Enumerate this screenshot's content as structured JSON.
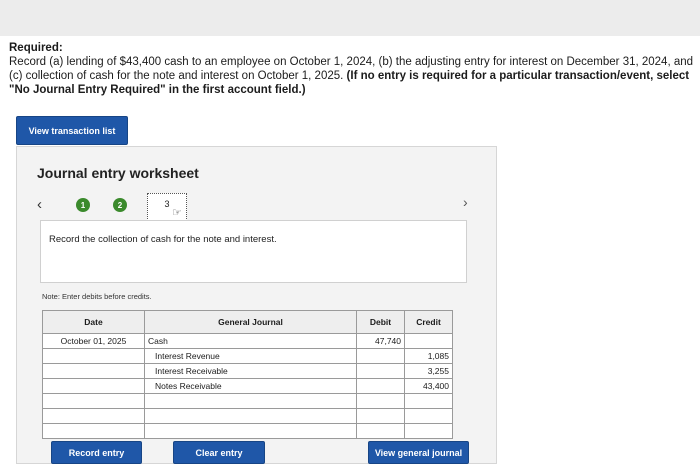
{
  "required": {
    "title": "Required:",
    "body": "Record (a) lending of $43,400 cash to an employee on October 1, 2024, (b) the adjusting entry for interest on December 31, 2024, and (c) collection of cash for the note and interest on October 1, 2025.",
    "bold_note": "(If no entry is required for a particular transaction/event, select \"No Journal Entry Required\" in the first account field.)"
  },
  "buttons": {
    "view_transaction_list": "View transaction list",
    "record_entry": "Record entry",
    "clear_entry": "Clear entry",
    "view_general_journal": "View general journal"
  },
  "worksheet": {
    "title": "Journal entry worksheet",
    "steps": [
      "1",
      "2",
      "3"
    ],
    "current_step": 3,
    "instruction": "Record the collection of cash for the note and interest.",
    "note": "Note: Enter debits before credits."
  },
  "journal": {
    "headers": {
      "date": "Date",
      "account": "General Journal",
      "debit": "Debit",
      "credit": "Credit"
    },
    "rows": [
      {
        "date": "October 01, 2025",
        "account": "Cash",
        "debit": "47,740",
        "credit": "",
        "indent": false
      },
      {
        "date": "",
        "account": "Interest Revenue",
        "debit": "",
        "credit": "1,085",
        "indent": true
      },
      {
        "date": "",
        "account": "Interest Receivable",
        "debit": "",
        "credit": "3,255",
        "indent": true
      },
      {
        "date": "",
        "account": "Notes Receivable",
        "debit": "",
        "credit": "43,400",
        "indent": true
      },
      {
        "date": "",
        "account": "",
        "debit": "",
        "credit": "",
        "indent": false
      },
      {
        "date": "",
        "account": "",
        "debit": "",
        "credit": "",
        "indent": false
      },
      {
        "date": "",
        "account": "",
        "debit": "",
        "credit": "",
        "indent": false
      }
    ]
  },
  "icons": {
    "prev": "chevron-left-icon",
    "next": "chevron-right-icon",
    "cursor": "hand-cursor-icon"
  },
  "colors": {
    "button": "#1f57a8",
    "step_complete": "#3b8a2c",
    "panel_bg": "#f3f3f3"
  }
}
